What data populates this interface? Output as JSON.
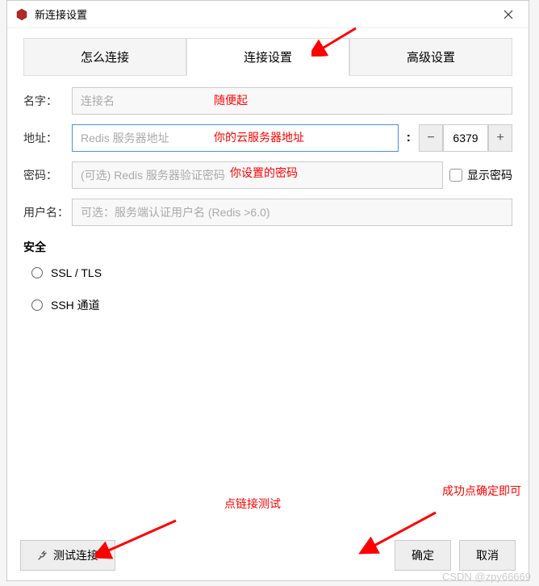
{
  "dialog": {
    "title": "新连接设置"
  },
  "tabs": {
    "how": "怎么连接",
    "connection": "连接设置",
    "advanced": "高级设置"
  },
  "form": {
    "name_label": "名字：",
    "name_placeholder": "连接名",
    "addr_label": "地址：",
    "addr_placeholder": "Redis 服务器地址",
    "colon": ":",
    "port_value": "6379",
    "password_label": "密码：",
    "password_placeholder": "(可选) Redis 服务器验证密码",
    "show_password": "显示密码",
    "username_label": "用户名：",
    "username_placeholder": "可选：服务端认证用户名 (Redis >6.0)"
  },
  "security": {
    "title": "安全",
    "ssl": "SSL / TLS",
    "ssh": "SSH 通道"
  },
  "footer": {
    "test": "测试连接",
    "ok": "确定",
    "cancel": "取消"
  },
  "annotations": {
    "name_hint": "随便起",
    "addr_hint": "你的云服务器地址",
    "password_hint": "你设置的密码",
    "test_hint": "点链接测试",
    "ok_hint": "成功点确定即可"
  },
  "watermark": "CSDN @zpy66669"
}
